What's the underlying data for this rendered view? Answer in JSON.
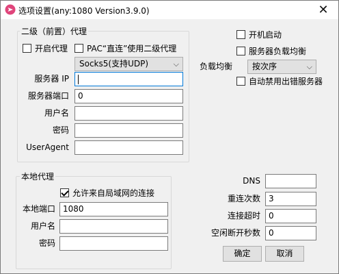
{
  "window": {
    "title": "选项设置(any:1080 Version3.9.0)",
    "close_glyph": "✕",
    "accent_color": "#0078d7"
  },
  "upstream_proxy": {
    "group_title": "二级（前置）代理",
    "enable_proxy_label": "开启代理",
    "enable_proxy_checked": false,
    "pac_direct_label": "PAC“直连”使用二级代理",
    "pac_direct_checked": false,
    "proxy_type": "Socks5(支持UDP)",
    "server_ip_label": "服务器 IP",
    "server_ip_value": "",
    "server_port_label": "服务器端口",
    "server_port_value": "0",
    "username_label": "用户名",
    "username_value": "",
    "password_label": "密码",
    "password_value": "",
    "useragent_label": "UserAgent",
    "useragent_value": ""
  },
  "startup": {
    "autostart_label": "开机启动",
    "autostart_checked": false,
    "server_lb_label": "服务器负载均衡",
    "server_lb_checked": false,
    "lb_label": "负载均衡",
    "lb_mode": "按次序",
    "auto_disable_label": "自动禁用出错服务器",
    "auto_disable_checked": false
  },
  "local_proxy": {
    "group_title": "本地代理",
    "allow_lan_label": "允许来自局域网的连接",
    "allow_lan_checked": true,
    "local_port_label": "本地端口",
    "local_port_value": "1080",
    "username_label": "用户名",
    "username_value": "",
    "password_label": "密码",
    "password_value": ""
  },
  "connection": {
    "dns_label": "DNS",
    "dns_value": "",
    "retry_label": "重连次数",
    "retry_value": "3",
    "timeout_label": "连接超时",
    "timeout_value": "0",
    "idle_label": "空闲断开秒数",
    "idle_value": "0"
  },
  "buttons": {
    "ok_label": "确定",
    "cancel_label": "取消"
  }
}
